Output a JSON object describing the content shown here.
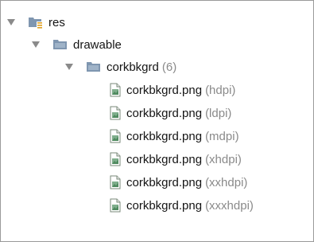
{
  "tree": {
    "root": {
      "label": "res",
      "expanded": true,
      "icon": "resource-folder-icon"
    },
    "folder": {
      "label": "drawable",
      "expanded": true,
      "icon": "folder-icon"
    },
    "group": {
      "label": "corkbkgrd",
      "count": "(6)",
      "expanded": true,
      "icon": "folder-icon"
    },
    "files": [
      {
        "label": "corkbkgrd.png",
        "qualifier": "(hdpi)",
        "icon": "image-file-icon"
      },
      {
        "label": "corkbkgrd.png",
        "qualifier": "(ldpi)",
        "icon": "image-file-icon"
      },
      {
        "label": "corkbkgrd.png",
        "qualifier": "(mdpi)",
        "icon": "image-file-icon"
      },
      {
        "label": "corkbkgrd.png",
        "qualifier": "(xhdpi)",
        "icon": "image-file-icon"
      },
      {
        "label": "corkbkgrd.png",
        "qualifier": "(xxhdpi)",
        "icon": "image-file-icon"
      },
      {
        "label": "corkbkgrd.png",
        "qualifier": "(xxxhdpi)",
        "icon": "image-file-icon"
      }
    ]
  },
  "colors": {
    "folder": "#7f96b0",
    "arrow": "#8a8a8a",
    "qualifier": "#8a8a8a"
  }
}
